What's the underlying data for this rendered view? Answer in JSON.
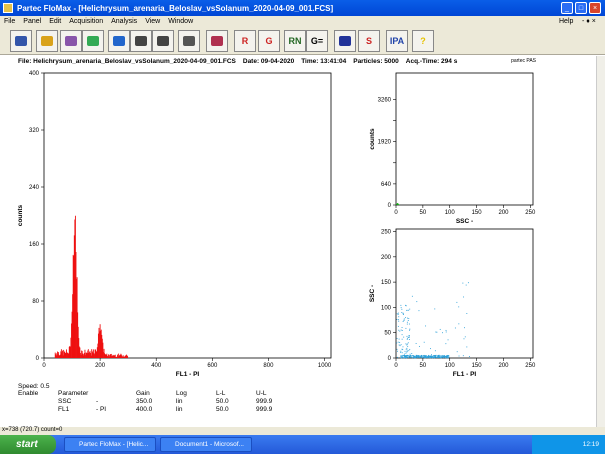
{
  "window": {
    "title": "Partec FloMax - [Helichrysum_arenaria_Beloslav_vsSolanum_2020-04-09_001.FCS]",
    "minimize": "_",
    "maximize": "□",
    "close": "×"
  },
  "menu": {
    "items": [
      "File",
      "Panel",
      "Edit",
      "Acquisition",
      "Analysis",
      "View",
      "Window"
    ],
    "help": "Help",
    "controls": "- ♦ ×"
  },
  "toolbar": {
    "buttons": [
      {
        "label": "",
        "icon": "panel-icon"
      },
      {
        "label": "",
        "icon": "open-folder-icon"
      },
      {
        "label": "",
        "icon": "open-data-icon"
      },
      {
        "label": "",
        "icon": "open-protocol-icon"
      },
      {
        "label": "",
        "icon": "acquisition-icon"
      },
      {
        "label": "",
        "icon": "save-icon"
      },
      {
        "label": "",
        "icon": "print-icon"
      },
      {
        "label": "",
        "icon": "print-preview-icon"
      },
      {
        "label": "",
        "icon": "zoom-icon"
      },
      {
        "label": "R",
        "icon": "region-icon"
      },
      {
        "label": "G",
        "icon": "gate-icon"
      },
      {
        "label": "RN",
        "icon": "region-number-icon"
      },
      {
        "label": "G=",
        "icon": "gate-equals-icon"
      },
      {
        "label": "",
        "icon": "cursor-icon"
      },
      {
        "label": "S",
        "icon": "statistics-icon"
      },
      {
        "label": "IPA",
        "icon": "ipa-icon"
      },
      {
        "label": "?",
        "icon": "help-icon"
      }
    ]
  },
  "file_info": {
    "file": "File: Helichrysum_arenaria_Beloslav_vsSolanum_2020-04-09_001.FCS",
    "date": "Date: 09-04-2020",
    "time": "Time: 13:41:04",
    "particles": "Particles: 5000",
    "acq_time": "Acq.-Time: 294 s",
    "brand": "partec PAS"
  },
  "chart_data": [
    {
      "type": "histogram",
      "xlabel": "FL1 - PI",
      "ylabel": "counts",
      "xlim": [
        0,
        1023
      ],
      "ylim": [
        0,
        400
      ],
      "xticks": [
        0,
        200,
        400,
        600,
        800,
        1000
      ],
      "yticks": [
        0,
        80,
        160,
        240,
        320,
        400
      ],
      "color": "#ee1111",
      "peaks": [
        {
          "center": 110,
          "height": 205,
          "width": 7
        },
        {
          "center": 200,
          "height": 45,
          "width": 6
        }
      ],
      "baseline_range": [
        40,
        300
      ],
      "baseline_height": 6
    },
    {
      "type": "histogram",
      "xlabel": "SSC -",
      "ylabel": "counts",
      "xlim": [
        0,
        255
      ],
      "ylim": [
        0,
        4000
      ],
      "xticks": [
        0,
        50,
        100,
        150,
        200,
        250
      ],
      "yticks": [
        0,
        640,
        1280,
        1920,
        2560,
        3200
      ],
      "ytick_labels": [
        "0",
        "640",
        "",
        "1920",
        "",
        "3260"
      ],
      "color": "#11aa11",
      "peak": {
        "center": 3,
        "height": 60
      }
    },
    {
      "type": "scatter",
      "xlabel": "FL1 - PI",
      "ylabel": "SSC -",
      "xlim": [
        0,
        255
      ],
      "ylim": [
        0,
        255
      ],
      "xticks": [
        0,
        50,
        100,
        150,
        200,
        250
      ],
      "yticks": [
        0,
        50,
        100,
        150,
        200,
        250
      ],
      "color": "#2a9fd8"
    }
  ],
  "info_panel": {
    "speed": "Speed: 0.5",
    "headers": [
      "Enable",
      "Parameter",
      "Gain",
      "Log",
      "L-L",
      "U-L"
    ],
    "rows": [
      {
        "param": "SSC",
        "unit": "-",
        "gain": "350.0",
        "log": "lin",
        "ll": "50.0",
        "ul": "999.9"
      },
      {
        "param": "FL1",
        "unit": "- PI",
        "gain": "400.0",
        "log": "lin",
        "ll": "50.0",
        "ul": "999.9"
      }
    ]
  },
  "status": {
    "text": "x=738 (720.7) count=0"
  },
  "taskbar": {
    "start": "start",
    "items": [
      "Partec FloMax - [Helic...",
      "Document1 - Microsof..."
    ],
    "clock": "12:19"
  }
}
